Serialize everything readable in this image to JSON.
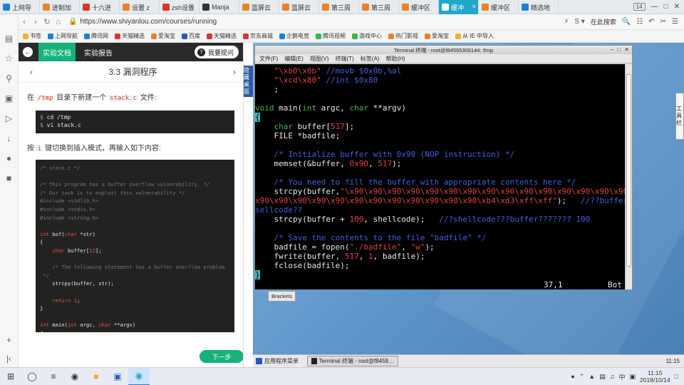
{
  "browser": {
    "tabs": [
      {
        "label": "上网导",
        "color": "#1e7ed8"
      },
      {
        "label": "进制加",
        "color": "#e8832a"
      },
      {
        "label": "十六进",
        "color": "#d8362b"
      },
      {
        "label": "设置 z",
        "color": "#e8832a"
      },
      {
        "label": "zsh设置",
        "color": "#d8362b"
      },
      {
        "label": "Manja",
        "color": "#333333"
      },
      {
        "label": "蓝屏云",
        "color": "#e8832a"
      },
      {
        "label": "蓝屏云",
        "color": "#e8832a"
      },
      {
        "label": "第三周",
        "color": "#e8832a"
      },
      {
        "label": "第三周",
        "color": "#e8832a"
      },
      {
        "label": "缓冲区",
        "color": "#e8832a"
      },
      {
        "label": "缓冲",
        "color": "#ffffff",
        "active": true
      },
      {
        "label": "缓冲区",
        "color": "#e8832a"
      },
      {
        "label": "精选地",
        "color": "#1e7ed8"
      }
    ],
    "tab_count": "14",
    "url": "https://www.shiyanlou.com/courses/running",
    "search_placeholder": "在此搜索",
    "bookmarks": [
      {
        "label": "书签",
        "color": "#f2b233"
      },
      {
        "label": "上网导航",
        "color": "#1e7ed8"
      },
      {
        "label": "腾讯网",
        "color": "#1e7ed8"
      },
      {
        "label": "天猫精选",
        "color": "#d8362b"
      },
      {
        "label": "爱淘宝",
        "color": "#e8832a"
      },
      {
        "label": "百度",
        "color": "#2a58c8"
      },
      {
        "label": "天猫精选",
        "color": "#d8362b"
      },
      {
        "label": "京东商城",
        "color": "#d8362b"
      },
      {
        "label": "企鹅电竞",
        "color": "#1e7ed8"
      },
      {
        "label": "腾讯视频",
        "color": "#3fb83f"
      },
      {
        "label": "游戏中心",
        "color": "#3fb83f"
      },
      {
        "label": "热门影视",
        "color": "#e8832a"
      },
      {
        "label": "爱淘宝",
        "color": "#e8832a"
      },
      {
        "label": "从 IE 中导入",
        "color": "#f2b233"
      }
    ]
  },
  "lab": {
    "tab_docs": "实验文档",
    "tab_report": "实验报告",
    "ask_label": "我要提问",
    "section_title": "3.3 漏洞程序",
    "para1_pre": "在",
    "para1_code1": "/tmp",
    "para1_mid": "目录下新建一个",
    "para1_code2": "stack.c",
    "para1_post": "文件:",
    "shell_lines": [
      "cd /tmp",
      "vi stack.c"
    ],
    "para2_pre": "按",
    "para2_code": "i",
    "para2_post": "键切换到插入模式，再输入如下内容:",
    "next_label": "下一步",
    "side_tab": "隐藏桌面"
  },
  "terminal": {
    "title": "Terminal 终端 - root@f84595306144: /tmp",
    "menu": [
      "文件(F)",
      "编辑(E)",
      "视图(V)",
      "终端(T)",
      "标签(A)",
      "帮助(H)"
    ],
    "status_pos": "37,1",
    "status_bot": "Bot"
  },
  "desktop": {
    "brackets": "Brackets",
    "right_widget": "工具栏",
    "vm_start": "应用程序菜单",
    "vm_window": "Terminal 终端 - root@f8459…",
    "vm_clock": "11:15"
  },
  "taskbar": {
    "time": "11:15",
    "date": "2018/10/14",
    "lang": "中"
  }
}
